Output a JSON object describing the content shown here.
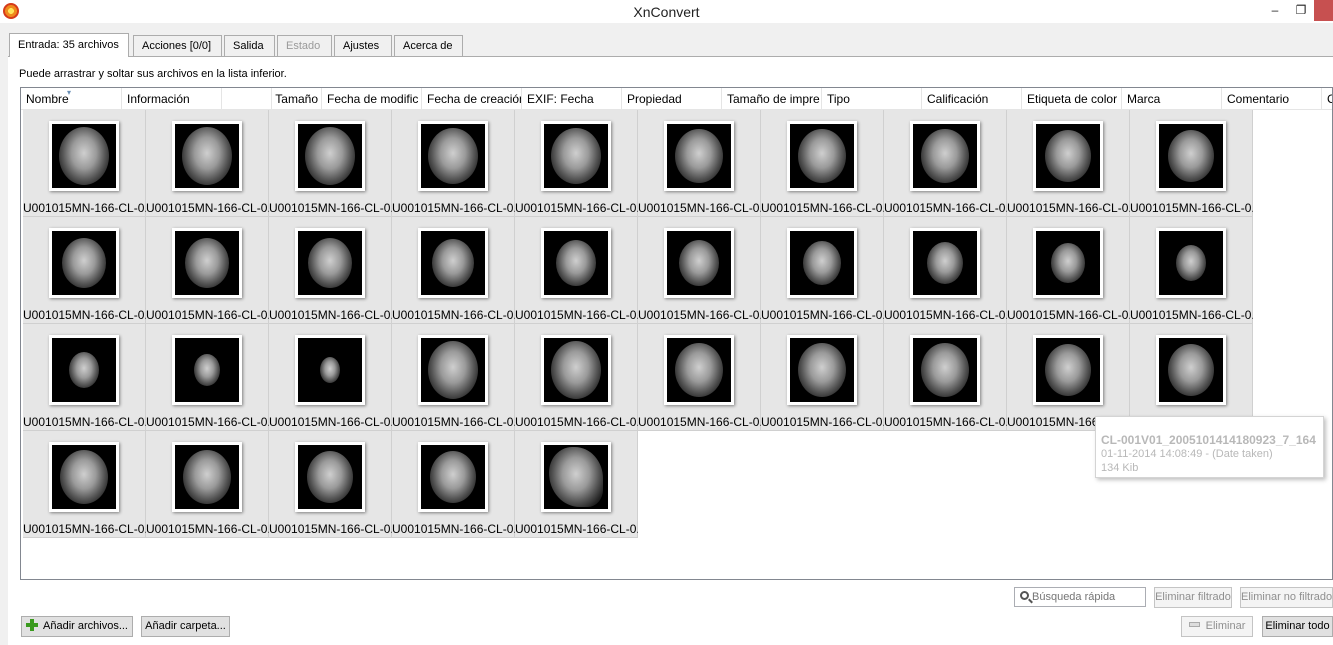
{
  "window": {
    "title": "XnConvert",
    "minimize": "‒",
    "maximize": "❐",
    "close": "✕"
  },
  "tabs": [
    {
      "label": "Entrada: 35 archivos"
    },
    {
      "label": "Acciones [0/0]"
    },
    {
      "label": "Salida"
    },
    {
      "label": "Estado"
    },
    {
      "label": "Ajustes"
    },
    {
      "label": "Acerca de"
    }
  ],
  "hint": "Puede arrastrar y soltar sus archivos en la lista inferior.",
  "columns": [
    "Nombre",
    "Información",
    "",
    "Tamaño",
    "Fecha de modific",
    "Fecha de creación",
    "EXIF: Fecha",
    "Propiedad",
    "Tamaño de impre",
    "Tipo",
    "",
    "Calificación",
    "Etiqueta de color",
    "Marca",
    "Comentario",
    "C"
  ],
  "files": [
    "U001015MN-166-CL-0.",
    "U001015MN-166-CL-0.",
    "U001015MN-166-CL-0.",
    "U001015MN-166-CL-0.",
    "U001015MN-166-CL-0.",
    "U001015MN-166-CL-0.",
    "U001015MN-166-CL-0.",
    "U001015MN-166-CL-0.",
    "U001015MN-166-CL-0.",
    "U001015MN-166-CL-0.",
    "U001015MN-166-CL-0.",
    "U001015MN-166-CL-0.",
    "U001015MN-166-CL-0.",
    "U001015MN-166-CL-0.",
    "U001015MN-166-CL-0.",
    "U001015MN-166-CL-0.",
    "U001015MN-166-CL-0.",
    "U001015MN-166-CL-0.",
    "U001015MN-166-CL-0.",
    "U001015MN-166-CL-0.",
    "U001015MN-166-CL-0.",
    "U001015MN-166-CL-0.",
    "U001015MN-166-CL-0.",
    "U001015MN-166-CL-0.",
    "U001015MN-166-CL-0.",
    "U001015MN-166-CL-0.",
    "U001015MN-166-CL-0.",
    "U001015MN-166-CL-0.",
    "U001015MN-166-CL-0.",
    "U001015MN-166-CL-0.",
    "U001015MN-166-CL-0.",
    "U001015MN-166-CL-0.",
    "U001015MN-166-CL-0.",
    "U001015MN-166-CL-0.",
    "U001015MN-166-CL-0."
  ],
  "tooltip": {
    "name": "CL-001V01_20051014141809​23_7_164",
    "date": "01-11-2014 14:08:49 - (Date taken)",
    "size": "134 Kib"
  },
  "search": {
    "placeholder": "Búsqueda rápida"
  },
  "buttons": {
    "remove_filtered": "Eliminar filtrado",
    "remove_unfiltered": "Eliminar no filtrado",
    "add_files": "Añadir archivos...",
    "add_folder": "Añadir carpeta...",
    "remove": "Eliminar",
    "remove_all": "Eliminar todo"
  }
}
